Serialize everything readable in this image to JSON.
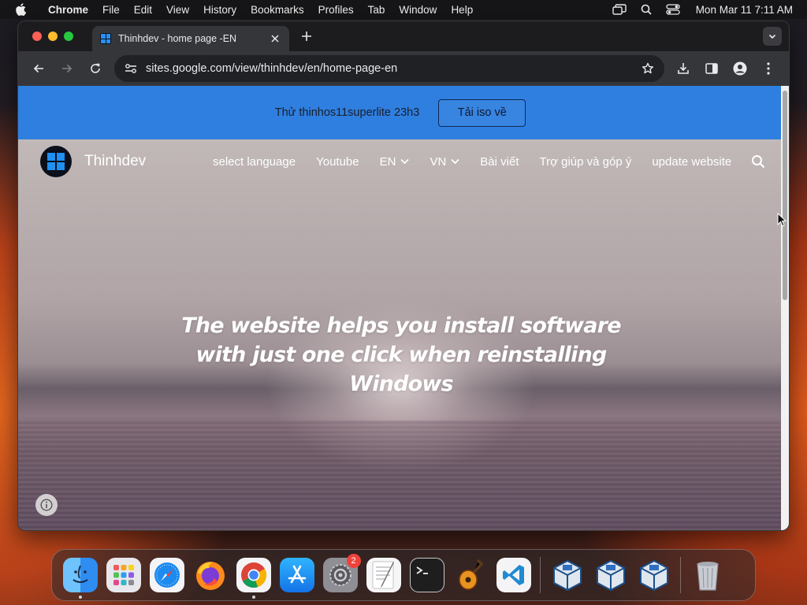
{
  "menubar": {
    "app_name": "Chrome",
    "items": [
      "File",
      "Edit",
      "View",
      "History",
      "Bookmarks",
      "Profiles",
      "Tab",
      "Window",
      "Help"
    ],
    "clock": "Mon Mar 11  7:11 AM"
  },
  "browser": {
    "tab_title": "Thinhdev - home page -EN",
    "url": "sites.google.com/view/thinhdev/en/home-page-en"
  },
  "page": {
    "banner_text": "Thử thinhos11superlite 23h3",
    "banner_button": "Tải iso về",
    "brand": "Thinhdev",
    "nav": {
      "select_language": "select language",
      "youtube": "Youtube",
      "en": "EN",
      "vn": "VN",
      "bai_viet": "Bài viết",
      "tro_giup": "Trợ giúp và góp ý",
      "update": "update website"
    },
    "hero": "The website helps you install software with just one click when reinstalling Windows"
  },
  "dock": {
    "settings_badge": "2"
  },
  "colors": {
    "banner": "#2f7fe0",
    "accent_blue": "#1f8ff2"
  }
}
